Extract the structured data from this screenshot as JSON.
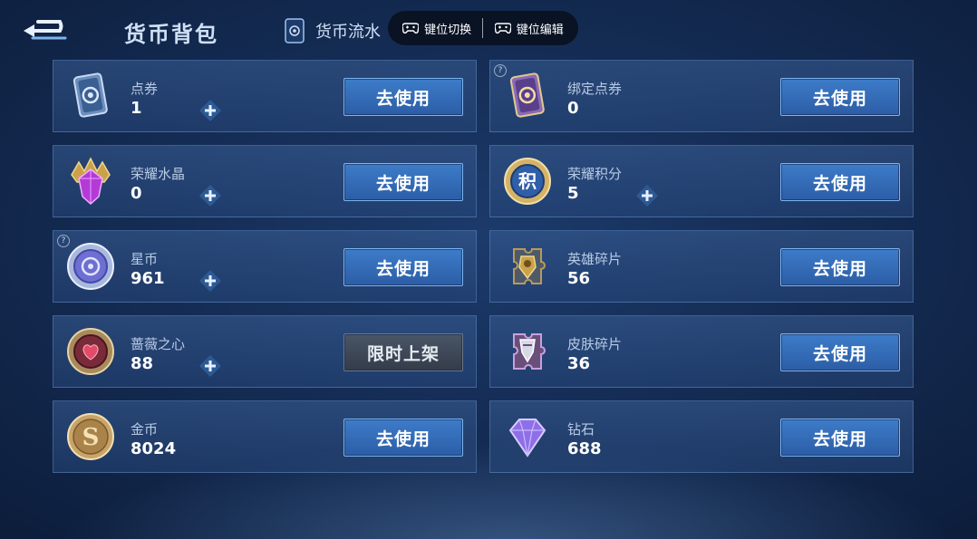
{
  "header": {
    "title": "货币背包",
    "flow_tab": "货币流水",
    "key_switch": "键位切换",
    "key_edit": "键位编辑"
  },
  "currencies": [
    {
      "name": "点券",
      "count": "1",
      "action": "去使用",
      "has_plus": true,
      "has_help": false,
      "icon": "coupon-card-icon"
    },
    {
      "name": "绑定点券",
      "count": "0",
      "action": "去使用",
      "has_plus": false,
      "has_help": true,
      "icon": "bound-coupon-card-icon"
    },
    {
      "name": "荣耀水晶",
      "count": "0",
      "action": "去使用",
      "has_plus": true,
      "has_help": false,
      "icon": "glory-crystal-icon"
    },
    {
      "name": "荣耀积分",
      "count": "5",
      "action": "去使用",
      "has_plus": true,
      "has_help": false,
      "icon": "glory-points-icon"
    },
    {
      "name": "星币",
      "count": "961",
      "action": "去使用",
      "has_plus": true,
      "has_help": true,
      "icon": "star-coin-icon"
    },
    {
      "name": "英雄碎片",
      "count": "56",
      "action": "去使用",
      "has_plus": false,
      "has_help": false,
      "icon": "hero-fragment-icon"
    },
    {
      "name": "蔷薇之心",
      "count": "88",
      "action": "限时上架",
      "has_plus": true,
      "has_help": false,
      "icon": "rose-heart-icon"
    },
    {
      "name": "皮肤碎片",
      "count": "36",
      "action": "去使用",
      "has_plus": false,
      "has_help": false,
      "icon": "skin-fragment-icon"
    },
    {
      "name": "金币",
      "count": "8024",
      "action": "去使用",
      "has_plus": false,
      "has_help": false,
      "icon": "gold-coin-icon"
    },
    {
      "name": "钻石",
      "count": "688",
      "action": "去使用",
      "has_plus": false,
      "has_help": false,
      "icon": "diamond-icon"
    }
  ],
  "colors": {
    "accent_button": "#3d7cc9",
    "limited_button": "#4a5566",
    "background": "#12284d"
  }
}
